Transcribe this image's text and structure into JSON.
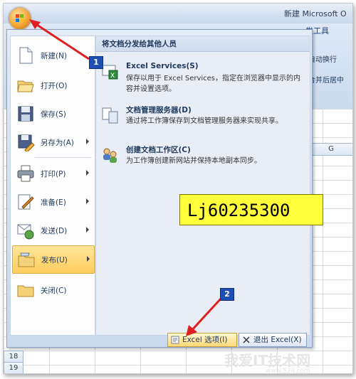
{
  "window": {
    "title": "新建 Microsoft O"
  },
  "ribbon": {
    "tab": "发工具",
    "btn_wrap": "自动换行",
    "btn_merge": "合并后居中"
  },
  "sheet": {
    "col_g": "G",
    "rows": [
      "18",
      "19"
    ]
  },
  "menu": {
    "items": [
      {
        "label": "新建(N)",
        "icon": "new-document-icon",
        "submenu": false
      },
      {
        "label": "打开(O)",
        "icon": "open-folder-icon",
        "submenu": false
      },
      {
        "label": "保存(S)",
        "icon": "save-disk-icon",
        "submenu": false
      },
      {
        "label": "另存为(A)",
        "icon": "save-as-icon",
        "submenu": true
      },
      {
        "label": "打印(P)",
        "icon": "printer-icon",
        "submenu": true
      },
      {
        "label": "准备(E)",
        "icon": "prepare-icon",
        "submenu": true
      },
      {
        "label": "发送(D)",
        "icon": "send-icon",
        "submenu": true
      },
      {
        "label": "发布(U)",
        "icon": "publish-icon",
        "submenu": true,
        "active": true
      },
      {
        "label": "关闭(C)",
        "icon": "close-folder-icon",
        "submenu": false
      }
    ],
    "pane_title": "将文档分发给其他人员",
    "subitems": [
      {
        "title": "Excel Services(S)",
        "desc": "保存以用于 Excel Services，指定在浏览器中显示的内容并设置选项。",
        "icon": "excel-services-icon"
      },
      {
        "title": "文档管理服务器(D)",
        "desc": "通过将工作簿保存到文档管理服务器来实现共享。",
        "icon": "document-server-icon"
      },
      {
        "title": "创建文档工作区(C)",
        "desc": "为工作簿创建新网站并保持本地副本同步。",
        "icon": "workspace-icon"
      }
    ],
    "options_button": "Excel 选项(I)",
    "exit_button": "退出 Excel(X)"
  },
  "annotations": {
    "badge1": "1",
    "badge2": "2",
    "code": "Lj60235300",
    "arrow_color": "#e02020"
  },
  "watermark": {
    "text": "我爱IT技术网",
    "url": "www.52ij.com"
  }
}
